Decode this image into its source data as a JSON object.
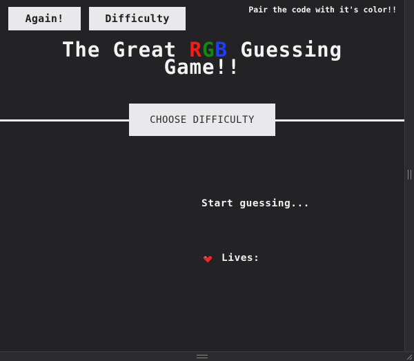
{
  "buttons": {
    "again_label": "Again!",
    "difficulty_label": "Difficulty",
    "choose_difficulty_label": "CHOOSE DIFFICULTY"
  },
  "tagline": "Pair the code with it's color!!",
  "title": {
    "prefix": "The Great ",
    "r": "R",
    "g": "G",
    "b": "B",
    "suffix": " Guessing",
    "line2": "Game!!"
  },
  "status_text": "Start guessing...",
  "lives": {
    "label": "Lives:",
    "icon": "heart-icon"
  },
  "colors": {
    "background": "#232224",
    "button_bg": "#e9e8ea",
    "text": "#f2f2f2",
    "rgb_r": "#ff1a1a",
    "rgb_g": "#0f8a0f",
    "rgb_b": "#1d3dff",
    "heart": "#e8262b"
  }
}
